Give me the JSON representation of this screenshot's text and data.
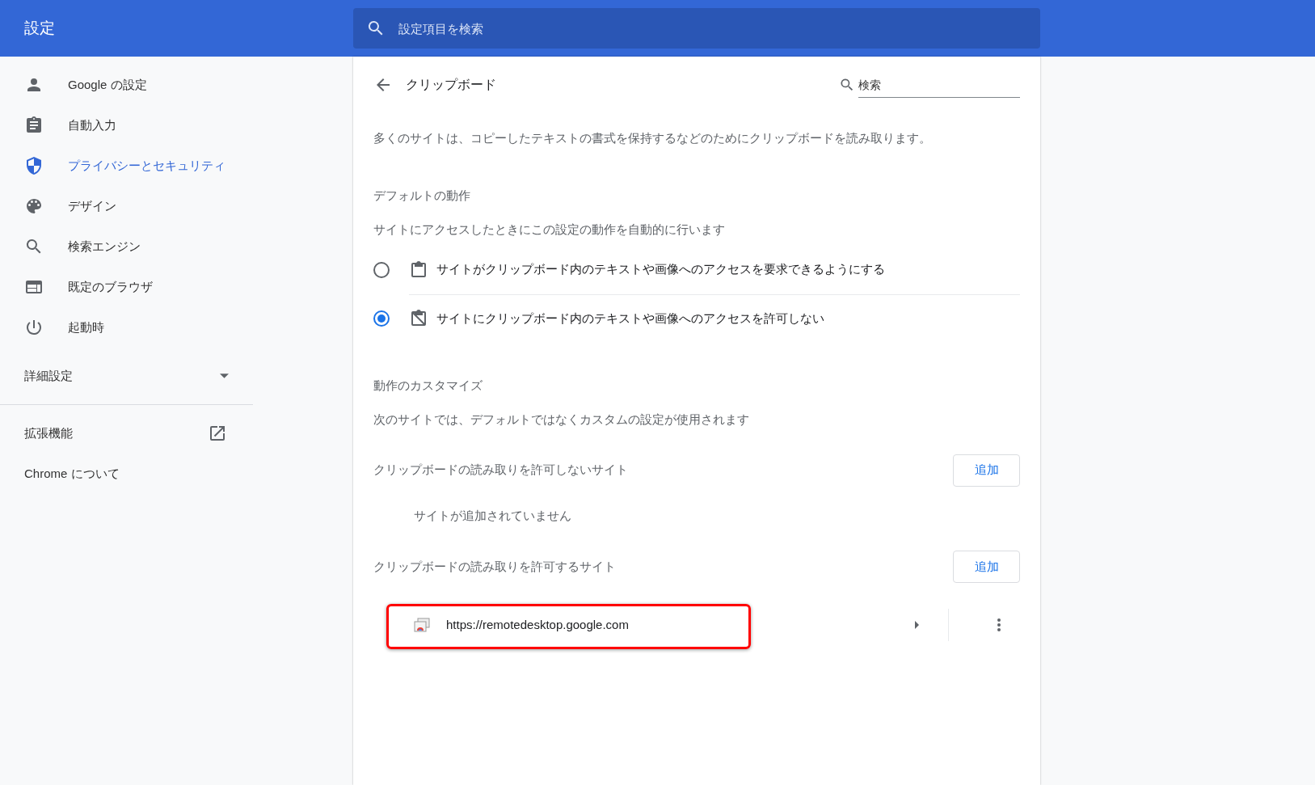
{
  "header": {
    "title": "設定",
    "search": {
      "placeholder": "設定項目を検索"
    }
  },
  "sidebar": {
    "items": [
      {
        "label": "Google の設定",
        "selected": false
      },
      {
        "label": "自動入力",
        "selected": false
      },
      {
        "label": "プライバシーとセキュリティ",
        "selected": true
      },
      {
        "label": "デザイン",
        "selected": false
      },
      {
        "label": "検索エンジン",
        "selected": false
      },
      {
        "label": "既定のブラウザ",
        "selected": false
      },
      {
        "label": "起動時",
        "selected": false
      }
    ],
    "advanced": {
      "label": "詳細設定",
      "expanded": false
    },
    "links": [
      {
        "label": "拡張機能",
        "external": true
      },
      {
        "label": "Chrome について",
        "external": false
      }
    ]
  },
  "page": {
    "title": "クリップボード",
    "search": {
      "placeholder": "検索"
    },
    "description": "多くのサイトは、コピーしたテキストの書式を保持するなどのためにクリップボードを読み取ります。",
    "default_behavior": {
      "heading": "デフォルトの動作",
      "subtitle": "サイトにアクセスしたときにこの設定の動作を自動的に行います",
      "options": [
        {
          "label": "サイトがクリップボード内のテキストや画像へのアクセスを要求できるようにする",
          "selected": false
        },
        {
          "label": "サイトにクリップボード内のテキストや画像へのアクセスを許可しない",
          "selected": true
        }
      ]
    },
    "customize": {
      "heading": "動作のカスタマイズ",
      "subtitle": "次のサイトでは、デフォルトではなくカスタムの設定が使用されます",
      "lists": [
        {
          "heading": "クリップボードの読み取りを許可しないサイト",
          "button": "追加",
          "empty_text": "サイトが追加されていません"
        },
        {
          "heading": "クリップボードの読み取りを許可するサイト",
          "button": "追加",
          "sites": [
            {
              "url": "https://remotedesktop.google.com",
              "highlighted": true
            }
          ]
        }
      ]
    }
  }
}
